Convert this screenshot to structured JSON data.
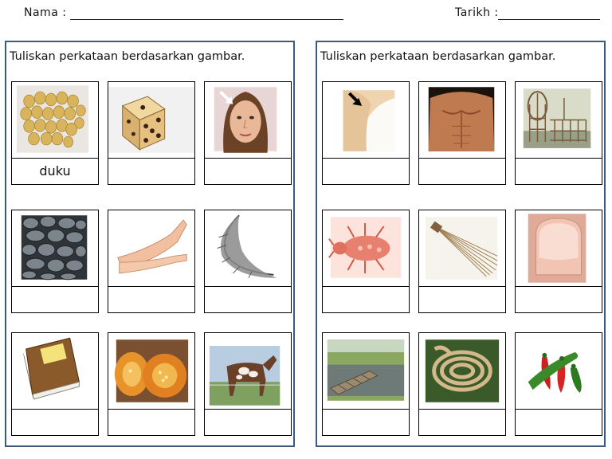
{
  "header": {
    "name_label": "Nama :",
    "date_label": "Tarikh :"
  },
  "panels": [
    {
      "instruction": "Tuliskan perkataan berdasarkan gambar.",
      "cards": [
        {
          "icon": "duku-fruit-icon",
          "answer": "duku"
        },
        {
          "icon": "dice-icon",
          "answer": ""
        },
        {
          "icon": "face-icon",
          "answer": ""
        },
        {
          "icon": "stones-icon",
          "answer": ""
        },
        {
          "icon": "legs-icon",
          "answer": ""
        },
        {
          "icon": "feather-icon",
          "answer": ""
        },
        {
          "icon": "book-icon",
          "answer": ""
        },
        {
          "icon": "pumpkin-icon",
          "answer": ""
        },
        {
          "icon": "horse-icon",
          "answer": ""
        }
      ]
    },
    {
      "instruction": "Tuliskan perkataan berdasarkan gambar.",
      "cards": [
        {
          "icon": "shoulder-icon",
          "answer": ""
        },
        {
          "icon": "chest-icon",
          "answer": ""
        },
        {
          "icon": "fish-trap-icon",
          "answer": ""
        },
        {
          "icon": "louse-icon",
          "answer": ""
        },
        {
          "icon": "broom-straw-icon",
          "answer": ""
        },
        {
          "icon": "fingernail-icon",
          "answer": ""
        },
        {
          "icon": "bridge-icon",
          "answer": ""
        },
        {
          "icon": "rope-icon",
          "answer": ""
        },
        {
          "icon": "chili-icon",
          "answer": ""
        }
      ]
    }
  ]
}
